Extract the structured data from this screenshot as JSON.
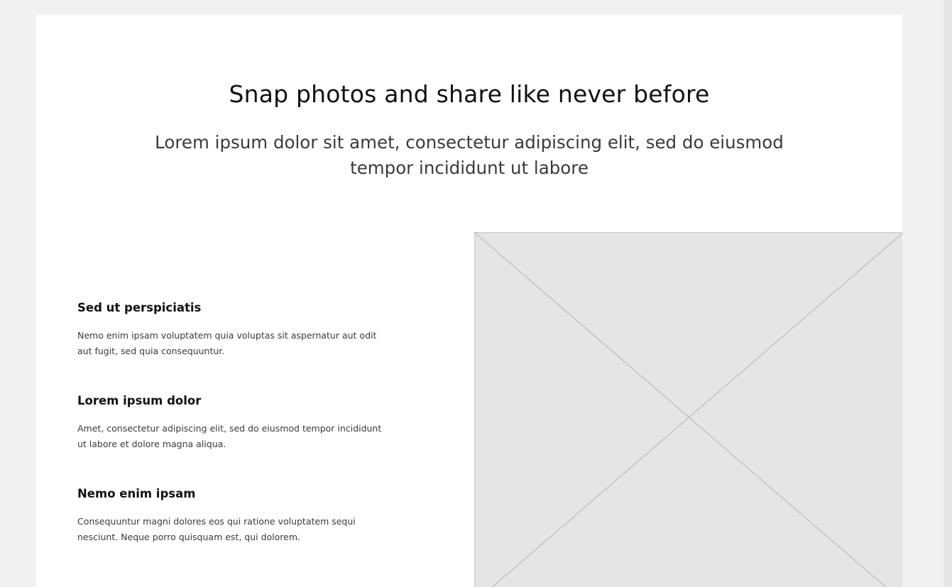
{
  "hero": {
    "title": "Snap photos and share like never before",
    "subtitle": "Lorem ipsum dolor sit amet, consectetur adipiscing elit, sed do eiusmod tempor incididunt ut labore"
  },
  "features": [
    {
      "title": "Sed ut perspiciatis",
      "text": "Nemo enim ipsam voluptatem quia voluptas sit aspernatur aut odit aut fugit, sed quia consequuntur."
    },
    {
      "title": "Lorem ipsum dolor",
      "text": "Amet, consectetur adipiscing elit, sed do eiusmod tempor incididunt ut labore et dolore magna aliqua."
    },
    {
      "title": "Nemo enim ipsam",
      "text": "Consequuntur magni dolores eos qui ratione voluptatem sequi nesciunt. Neque porro quisquam est, qui dolorem."
    }
  ],
  "image": {
    "icon": "image-placeholder-icon"
  },
  "colors": {
    "page_background": "#f1f1f1",
    "card_background": "#ffffff",
    "placeholder_fill": "#e5e5e5",
    "placeholder_line": "#b3b3b3"
  }
}
